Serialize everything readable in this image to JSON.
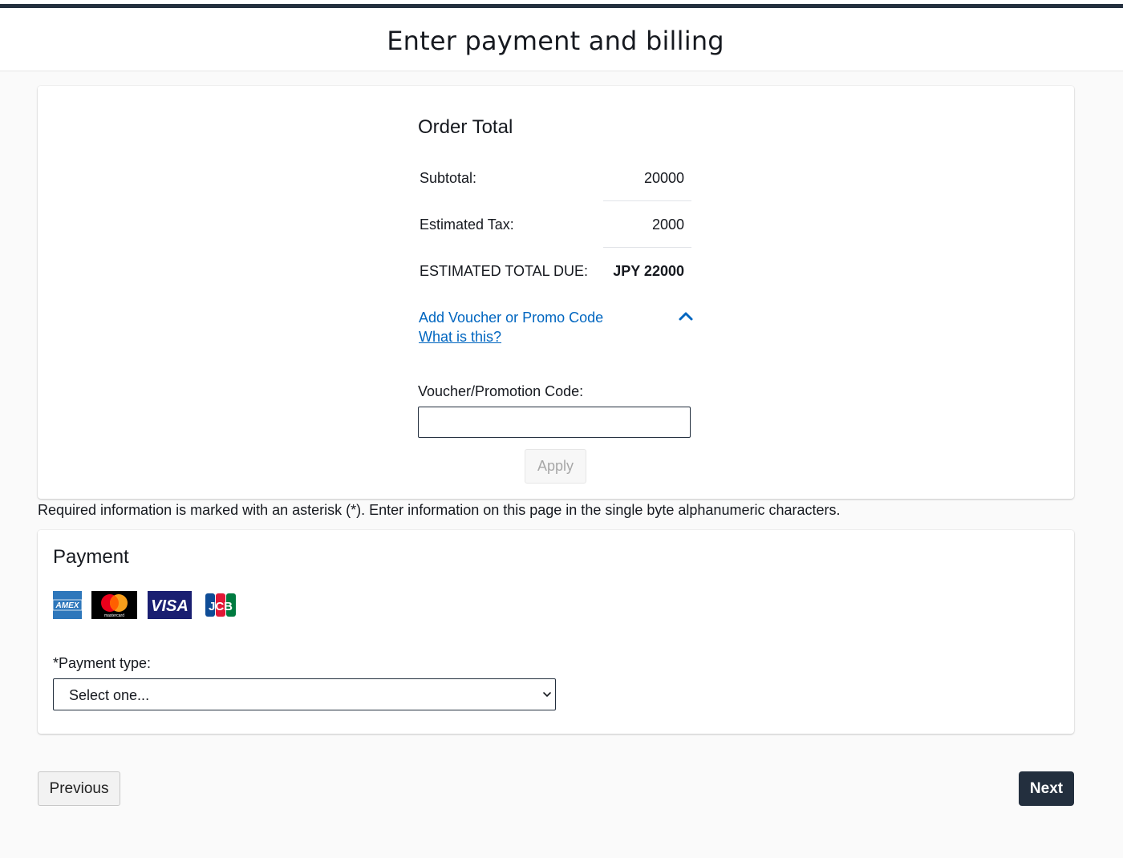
{
  "header": {
    "title": "Enter payment and billing"
  },
  "order_total": {
    "title": "Order Total",
    "subtotal_label": "Subtotal:",
    "subtotal_value": "20000",
    "tax_label": "Estimated Tax:",
    "tax_value": "2000",
    "total_label": "ESTIMATED TOTAL DUE:",
    "total_value": "JPY 22000",
    "promo_toggle_label": "Add Voucher or Promo Code",
    "promo_help_link": "What is this?",
    "voucher_label": "Voucher/Promotion Code:",
    "voucher_value": "",
    "apply_label": "Apply"
  },
  "required_note": "Required information is marked with an asterisk (*). Enter information on this page in the single byte alphanumeric characters.",
  "payment": {
    "title": "Payment",
    "card_logos": [
      {
        "icon": "amex-icon",
        "text": "AMEX",
        "color": "#2e77bb"
      },
      {
        "icon": "mastercard-icon",
        "text": "mastercard",
        "color": "#eb001b"
      },
      {
        "icon": "visa-icon",
        "text": "VISA",
        "color": "#1a1f71"
      },
      {
        "icon": "jcb-icon",
        "text": "JCB",
        "color": "#0e4c96"
      }
    ],
    "type_label": "*Payment type:",
    "type_selected": "Select one..."
  },
  "navigation": {
    "previous_label": "Previous",
    "next_label": "Next"
  },
  "colors": {
    "brand_dark": "#232f3e",
    "link": "#0066c0"
  }
}
